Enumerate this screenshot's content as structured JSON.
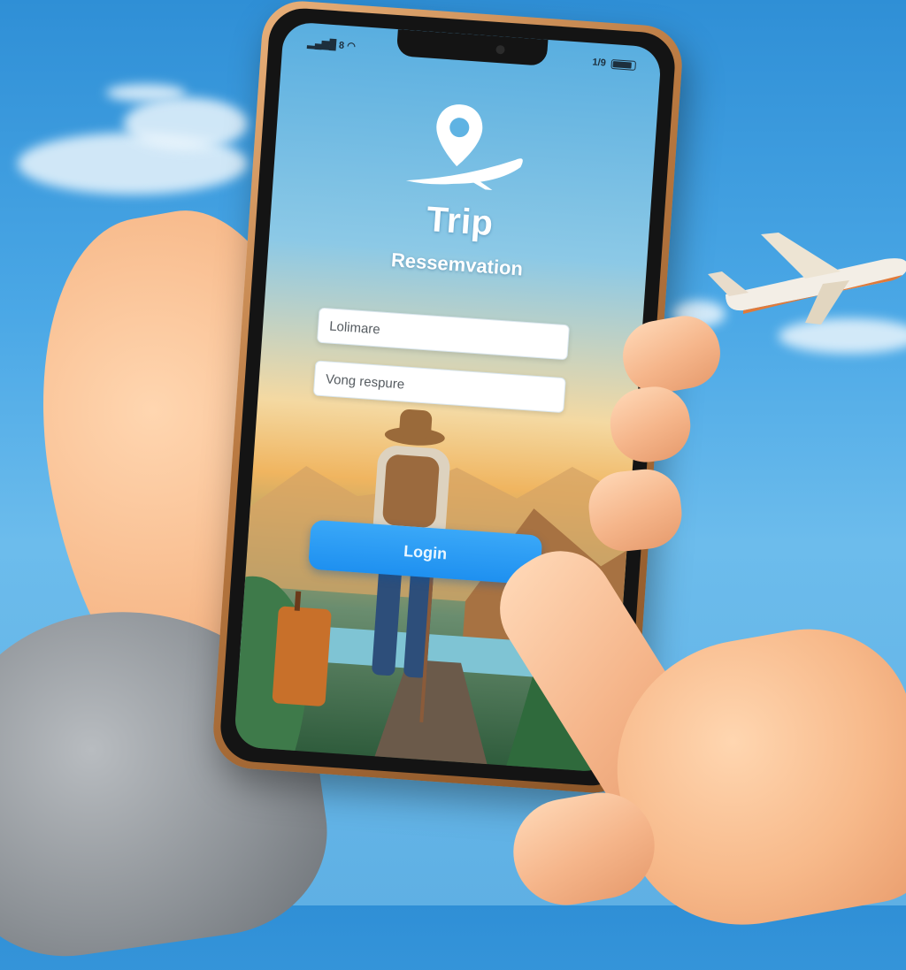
{
  "status_bar": {
    "left": "▂▄▆█ 8",
    "right": "1/9"
  },
  "app": {
    "title": "Trip",
    "subtitle": "Ressemvation",
    "logo_icon": "map-pin-plane-icon"
  },
  "form": {
    "username_value": "Lolimare",
    "password_value": "Vong respure",
    "login_label": "Login"
  },
  "colors": {
    "accent": "#1e90f0",
    "phone_frame": "#b87840",
    "sky": "#4ba8e6"
  }
}
